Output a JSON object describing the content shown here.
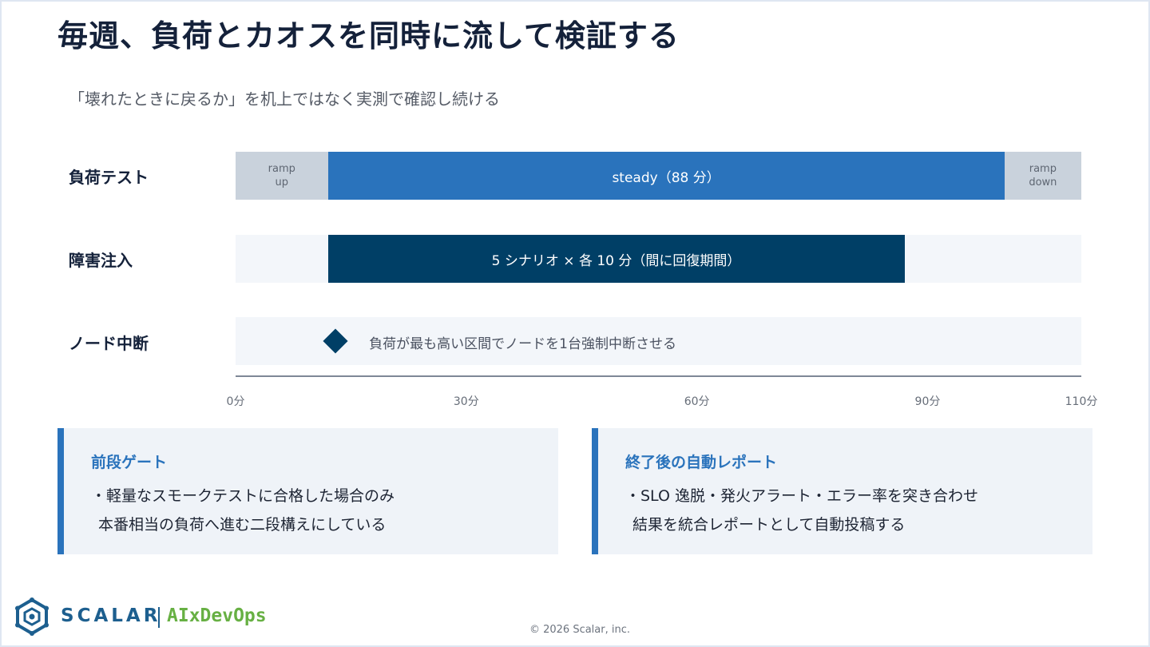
{
  "title": "毎週、負荷とカオスを同時に流して検証する",
  "subtitle": "「壊れたときに戻るか」を机上ではなく実測で確認し続ける",
  "timeline": {
    "axis_max_minutes": 110,
    "ticks": [
      "0分",
      "30分",
      "60分",
      "90分",
      "110分"
    ],
    "rows": [
      {
        "label": "負荷テスト",
        "segments": [
          {
            "name": "ramp-up",
            "label": "ramp\nup",
            "style": "gray",
            "start": 0,
            "end": 12
          },
          {
            "name": "steady",
            "label": "steady（88 分）",
            "style": "blue",
            "start": 12,
            "end": 100
          },
          {
            "name": "ramp-down",
            "label": "ramp\ndown",
            "style": "gray",
            "start": 100,
            "end": 110
          }
        ]
      },
      {
        "label": "障害注入",
        "segments": [
          {
            "name": "fault-scenarios",
            "label": "5 シナリオ × 各 10 分（間に回復期間）",
            "style": "navy",
            "start": 12,
            "end": 87
          }
        ]
      },
      {
        "label": "ノード中断",
        "event": {
          "at": 13,
          "label": "負荷が最も高い区間でノードを1台強制中断させる"
        }
      }
    ]
  },
  "cards": [
    {
      "title": "前段ゲート",
      "lines": [
        "・軽量なスモークテストに合格した場合のみ",
        "本番相当の負荷へ進む二段構えにしている"
      ]
    },
    {
      "title": "終了後の自動レポート",
      "lines": [
        "・SLO 逸脱・発火アラート・エラー率を突き合わせ",
        "結果を統合レポートとして自動投稿する"
      ]
    }
  ],
  "footer": {
    "brand": "SCALAR",
    "brand_sub": "AIxDevOps",
    "copyright": "© 2026 Scalar, inc."
  },
  "colors": {
    "accent_blue": "#2a73bc",
    "navy": "#003f66",
    "gray_segment": "#c9d2dc",
    "track": "#f3f6fa",
    "card_bg": "#eff3f8",
    "brand_green": "#67b043"
  }
}
